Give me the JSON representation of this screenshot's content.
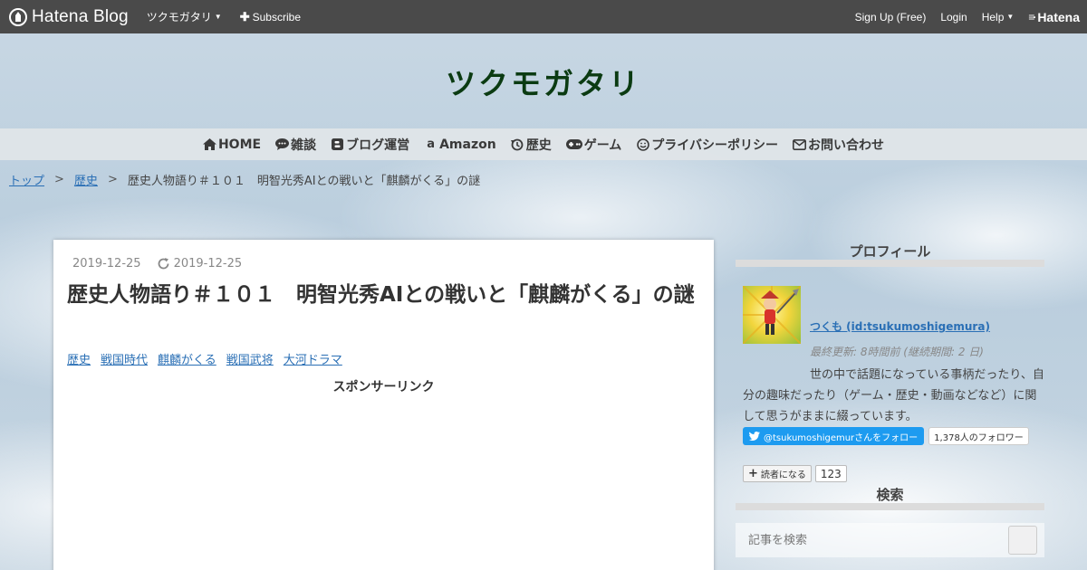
{
  "topbar": {
    "brand": "Hatena Blog",
    "blog_menu": "ツクモガタリ",
    "subscribe": "Subscribe",
    "signup": "Sign Up (Free)",
    "login": "Login",
    "help": "Help",
    "hatena": "Hatena"
  },
  "header": {
    "title": "ツクモガタリ",
    "title_color": "#0b3b12"
  },
  "nav": [
    {
      "label": "HOME",
      "icon": "home-icon"
    },
    {
      "label": "雑談",
      "icon": "comment-icon"
    },
    {
      "label": "ブログ運営",
      "icon": "blogger-icon"
    },
    {
      "label": "Amazon",
      "icon": "amazon-icon"
    },
    {
      "label": "歴史",
      "icon": "history-icon"
    },
    {
      "label": "ゲーム",
      "icon": "gamepad-icon"
    },
    {
      "label": "プライバシーポリシー",
      "icon": "smile-icon"
    },
    {
      "label": "お問い合わせ",
      "icon": "envelope-icon"
    }
  ],
  "breadcrumb": {
    "top": "トップ",
    "category": "歴史",
    "current": "歴史人物語り＃１０１　明智光秀AIとの戦いと「麒麟がくる」の謎",
    "separator": ">"
  },
  "article": {
    "date": "2019-12-25",
    "updated": "2019-12-25",
    "title": "歴史人物語り＃１０１　明智光秀AIとの戦いと「麒麟がくる」の謎",
    "categories": [
      "歴史",
      "戦国時代",
      "麒麟がくる",
      "戦国武将",
      "大河ドラマ"
    ],
    "sponsor": "スポンサーリンク"
  },
  "sidebar": {
    "profile_title": "プロフィール",
    "name": "つくも (id:tsukumoshigemura)",
    "updated": "最終更新: 8時間前 (継続期間: 2 日)",
    "description": "世の中で話題になっている事柄だったり、自分の趣味だったり（ゲーム・歴史・動画などなど）に関して思うがままに綴っています。",
    "twitter_follow": "@tsukumoshigemurさんをフォロー",
    "twitter_followers": "1,378人のフォロワー",
    "reader_button": "読者になる",
    "reader_count": "123",
    "search_title": "検索",
    "search_placeholder": "記事を検索"
  }
}
